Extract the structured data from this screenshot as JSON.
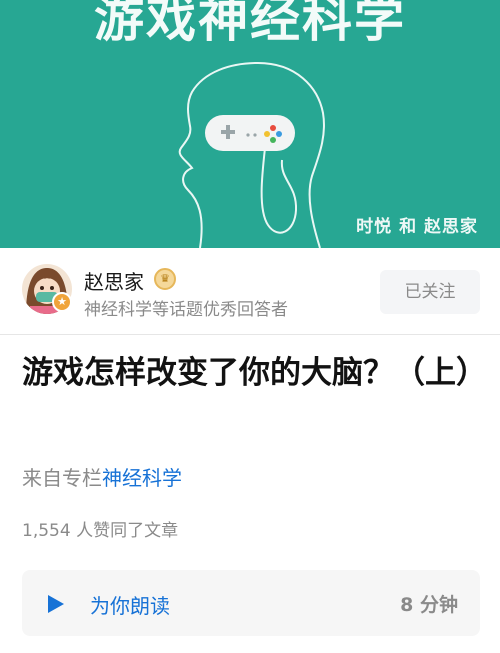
{
  "cover": {
    "title": "游戏神经科学",
    "credit": "时悦 和 赵思家",
    "background": "#27a793"
  },
  "author": {
    "name": "赵思家",
    "description": "神经科学等话题优秀回答者",
    "follow_label": "已关注",
    "badge_icon": "crown-icon",
    "avatar_badge_icon": "star-icon"
  },
  "article": {
    "title": "游戏怎样改变了你的大脑？（上）",
    "column_prefix": "来自专栏",
    "column_name": "神经科学",
    "votes": "1,554 人赞同了文章"
  },
  "listen": {
    "label": "为你朗读",
    "duration": "8 分钟",
    "icon": "play-icon",
    "accent": "#1772d6"
  }
}
